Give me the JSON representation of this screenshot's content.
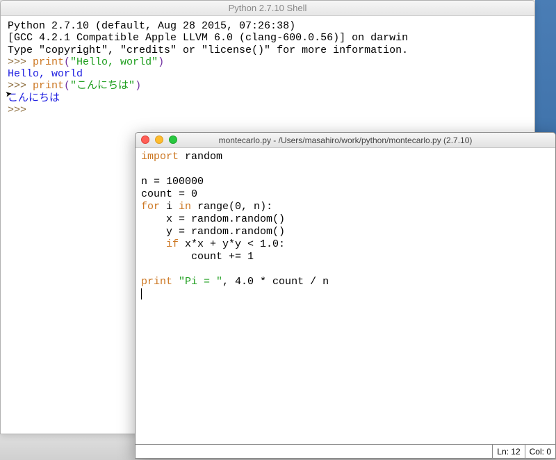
{
  "shell": {
    "title": "Python 2.7.10 Shell",
    "banner1": "Python 2.7.10 (default, Aug 28 2015, 07:26:38) ",
    "banner2": "[GCC 4.2.1 Compatible Apple LLVM 6.0 (clang-600.0.56)] on darwin",
    "banner3": "Type \"copyright\", \"credits\" or \"license()\" for more information.",
    "prompt": ">>> ",
    "line1_kw": "print",
    "line1_lpar": "(",
    "line1_str": "\"Hello, world\"",
    "line1_rpar": ")",
    "out1": "Hello, world",
    "line2_kw": "print",
    "line2_lpar": "(",
    "line2_str": "\"こんにちは\"",
    "line2_rpar": ")",
    "out2": "こんにちは"
  },
  "editor": {
    "title": "montecarlo.py - /Users/masahiro/work/python/montecarlo.py (2.7.10)",
    "code": {
      "l1_kw": "import",
      "l1_rest": " random",
      "blank": "",
      "l3": "n = 100000",
      "l4": "count = 0",
      "l5_for": "for",
      "l5_mid": " i ",
      "l5_in": "in",
      "l5_rest": " range(0, n):",
      "l6": "    x = random.random()",
      "l7": "    y = random.random()",
      "l8_pre": "    ",
      "l8_if": "if",
      "l8_rest": " x*x + y*y < 1.0:",
      "l9": "        count += 1",
      "l11_kw": "print",
      "l11_sp": " ",
      "l11_str": "\"Pi = \"",
      "l11_rest": ", 4.0 * count / n"
    },
    "status": {
      "ln": "Ln: 12",
      "col": "Col: 0"
    }
  }
}
